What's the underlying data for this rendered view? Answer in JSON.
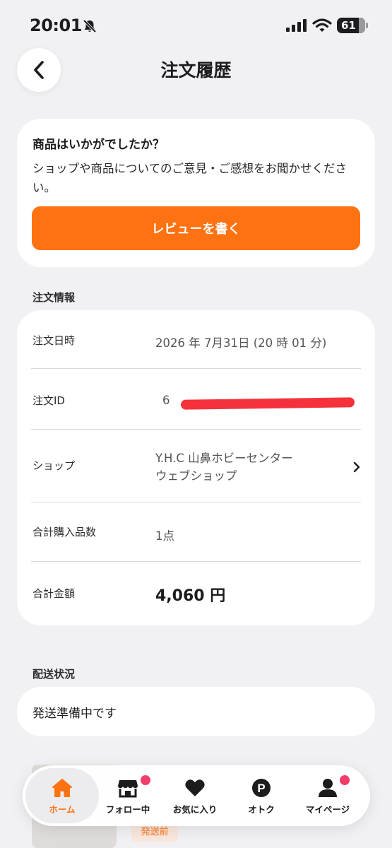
{
  "status": {
    "time": "20:01",
    "battery": "61"
  },
  "header": {
    "title": "注文履歴"
  },
  "review": {
    "question": "商品はいかがでしたか？",
    "message": "ショップや商品についてのご意見・ご感想をお聞かせください。",
    "button_label": "レビューを書く"
  },
  "order_info": {
    "section_label": "注文情報",
    "date_key": "注文日時",
    "date_value": "2026 年 7月31日 (20 時 01 分)",
    "id_key": "注文ID",
    "id_visible": "6",
    "shop_key": "ショップ",
    "shop_value_line1": "Y.H.C 山鼻ホビーセンター",
    "shop_value_line2": "ウェブショップ",
    "qty_key": "合計購入品数",
    "qty_value": "1点",
    "total_key": "合計金額",
    "total_value": "4,060 円"
  },
  "shipping": {
    "section_label": "配送状況",
    "status": "発送準備中です"
  },
  "peek": {
    "badge": "発送前"
  },
  "tabbar": {
    "items": [
      {
        "label": "ホーム",
        "icon": "home-icon",
        "active": true
      },
      {
        "label": "フォロー中",
        "icon": "shop-icon",
        "badge": true
      },
      {
        "label": "お気に入り",
        "icon": "heart-icon"
      },
      {
        "label": "オトク",
        "icon": "points-icon"
      },
      {
        "label": "マイページ",
        "icon": "person-icon",
        "badge": true
      }
    ]
  },
  "colors": {
    "accent": "#ff7212",
    "badge": "#f23d6b",
    "redaction": "#f5323b",
    "background": "#f1f1f4"
  }
}
